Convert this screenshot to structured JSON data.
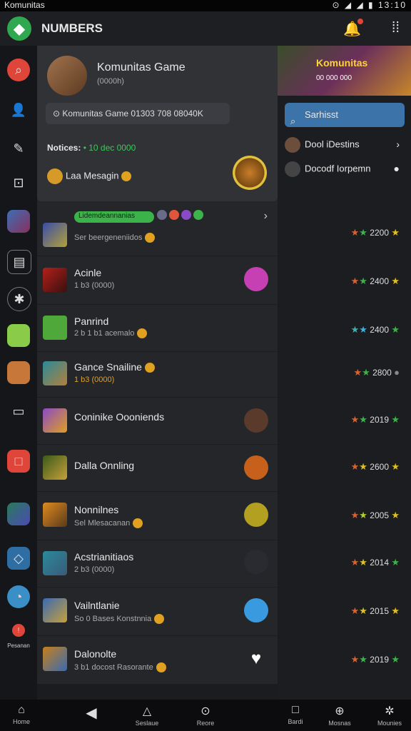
{
  "status": {
    "left": "Komunitas",
    "right": "13:10",
    "icons": "⊙ ◢ ◢ ▮"
  },
  "appbar": {
    "title": "NUMBERS",
    "logo_glyph": "◆",
    "bell_icon": "bell-icon",
    "grid_icon": "grid-icon"
  },
  "sidebar": {
    "label": "Pesanan",
    "items": [
      "search-icon",
      "person-icon",
      "pen-icon",
      "game-icon",
      "avatar",
      "doc-icon",
      "settings-icon",
      "avatar",
      "avatar",
      "screen-icon",
      "square-icon",
      "avatar",
      "shield-icon",
      "chat-icon",
      "alert-icon"
    ]
  },
  "card": {
    "title": "Komunitas Game",
    "subtitle": "(0000h)",
    "bar_text": "⊙ Komunitas Game 01303 708 08040K",
    "notice_label": "Notices:",
    "notice_value": "• 10 dec 0000",
    "message": "Laa Mesagin"
  },
  "rows": [
    {
      "title": "",
      "subtitle": "Ser beergeneniidos",
      "tag": "Lidemdeannanias",
      "rating": "2200"
    },
    {
      "title": "Acinle",
      "subtitle": "1 b3 (0000)",
      "rating": "2400"
    },
    {
      "title": "Panrind",
      "subtitle": "2 b 1 b1 acemalo",
      "rating": "2400"
    },
    {
      "title": "Gance Snailine",
      "subtitle": "1 b3 (0000)",
      "rating": "2800"
    },
    {
      "title": "Coninike Oooniends",
      "subtitle": "",
      "rating": "2019"
    },
    {
      "title": "Dalla Onnling",
      "subtitle": "",
      "rating": "2600"
    },
    {
      "title": "Nonnilnes",
      "subtitle": "Sel Mlesacanan",
      "rating": "2005"
    },
    {
      "title": "Acstrianitiaos",
      "subtitle": "2 b3 (0000)",
      "rating": "2014"
    },
    {
      "title": "Vailntlanie",
      "subtitle": "So 0 Bases Konstnnia",
      "rating": "2015"
    },
    {
      "title": "Dalonolte",
      "subtitle": "3 b1 docost Rasorante",
      "rating": "2019"
    }
  ],
  "right": {
    "banner_title": "Komunitas",
    "banner_sub": "00 000 000",
    "button": "Sarhisst",
    "list": [
      {
        "label": "Dool iDestins"
      },
      {
        "label": "Docodf Iorpemn"
      }
    ]
  },
  "bottom": [
    {
      "icon": "home-icon",
      "label": "Home"
    },
    {
      "icon": "back-icon",
      "label": ""
    },
    {
      "icon": "alert-icon",
      "label": "Seslaue"
    },
    {
      "icon": "search-icon",
      "label": "Reore"
    },
    {
      "icon": "square-icon",
      "label": "Bardi"
    },
    {
      "icon": "game-icon",
      "label": "Mosnas"
    },
    {
      "icon": "gear-icon",
      "label": "Mounies"
    }
  ]
}
